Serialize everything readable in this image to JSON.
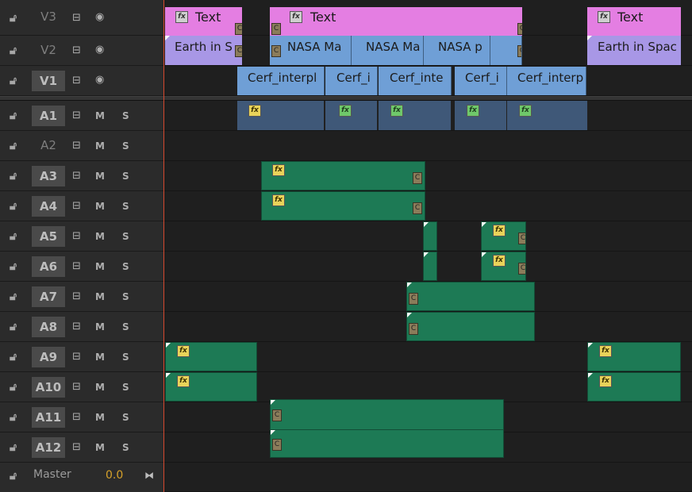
{
  "tracks": {
    "video": [
      {
        "name": "V3"
      },
      {
        "name": "V2"
      },
      {
        "name": "V1"
      }
    ],
    "audio": [
      {
        "name": "A1",
        "m": "M",
        "s": "S"
      },
      {
        "name": "A2",
        "m": "M",
        "s": "S"
      },
      {
        "name": "A3",
        "m": "M",
        "s": "S"
      },
      {
        "name": "A4",
        "m": "M",
        "s": "S"
      },
      {
        "name": "A5",
        "m": "M",
        "s": "S"
      },
      {
        "name": "A6",
        "m": "M",
        "s": "S"
      },
      {
        "name": "A7",
        "m": "M",
        "s": "S"
      },
      {
        "name": "A8",
        "m": "M",
        "s": "S"
      },
      {
        "name": "A9",
        "m": "M",
        "s": "S"
      },
      {
        "name": "A10",
        "m": "M",
        "s": "S"
      },
      {
        "name": "A11",
        "m": "M",
        "s": "S"
      },
      {
        "name": "A12",
        "m": "M",
        "s": "S"
      }
    ],
    "master": {
      "label": "Master",
      "volume": "0.0"
    }
  },
  "clips": {
    "v3": [
      "Text",
      "Text",
      "Text"
    ],
    "v2": [
      "Earth in S",
      "NASA Ma",
      "NASA Ma",
      "NASA p",
      "Earth in Spac"
    ],
    "v1": [
      "Cerf_interpl",
      "Cerf_i",
      "Cerf_inte",
      "Cerf_i",
      "Cerf_interp"
    ]
  },
  "icons": {
    "fx": "fx",
    "transition": "C"
  },
  "colors": {
    "title_clip": "#e47ee2",
    "sequence_clip": "#a897e6",
    "video_clip": "#6f9fd6",
    "audio_clip": "#1d7a55",
    "playhead": "#d6492e",
    "master_volume": "#d6a12a"
  }
}
